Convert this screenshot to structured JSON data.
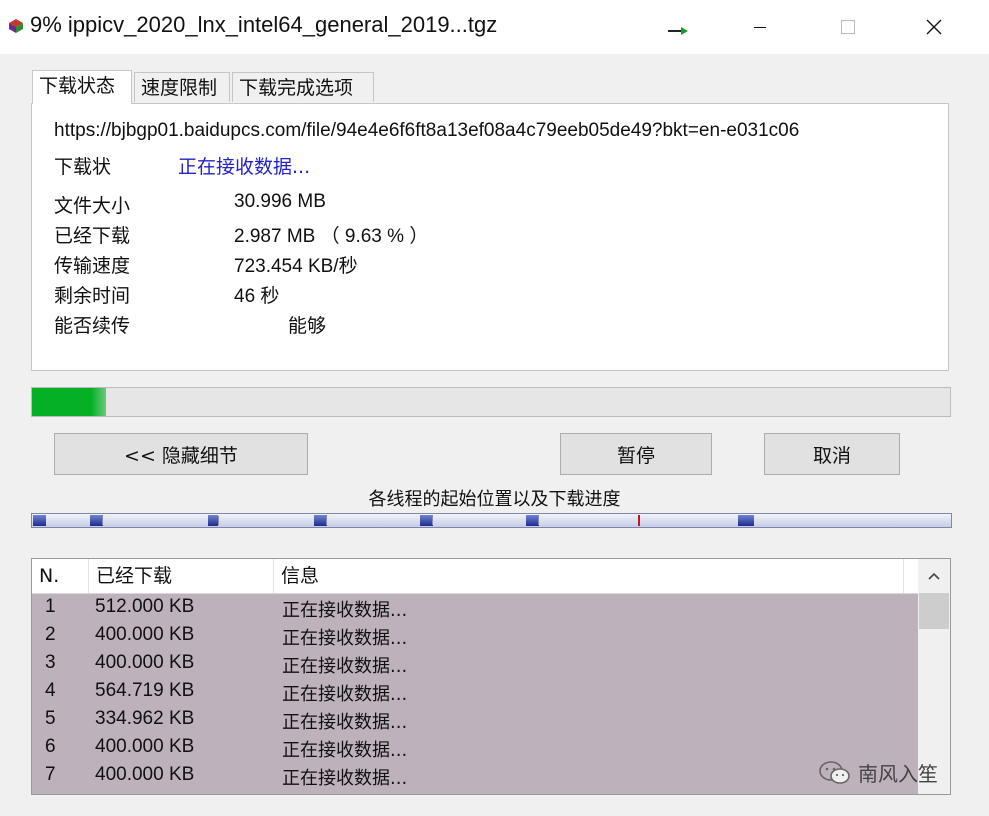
{
  "window": {
    "title": "9% ippicv_2020_lnx_intel64_general_2019...tgz",
    "controls": {
      "minimize": "—",
      "maximize": "☐",
      "close": "✕"
    }
  },
  "tabs": [
    {
      "label": "下载状态",
      "active": true
    },
    {
      "label": "速度限制",
      "active": false
    },
    {
      "label": "下载完成选项",
      "active": false
    }
  ],
  "status": {
    "url": "https://bjbgp01.baidupcs.com/file/94e4e6f6ft8a13ef08a4c79eeb05de49?bkt=en-e031c06",
    "state_label": "下载状",
    "state_value": "正在接收数据...",
    "rows": [
      {
        "label": "文件大小",
        "value": "30.996  MB"
      },
      {
        "label": "已经下载",
        "value": "2.987  MB （ 9.63 % ）"
      },
      {
        "label": "传输速度",
        "value": "723.454  KB/秒"
      },
      {
        "label": "剩余时间",
        "value": "46 秒"
      },
      {
        "label": "能否续传",
        "value": "能够"
      }
    ]
  },
  "progress": {
    "percent": 9.63
  },
  "buttons": {
    "hide_details": "<< 隐藏细节",
    "pause": "暂停",
    "cancel": "取消"
  },
  "threads": {
    "caption": "各线程的起始位置以及下载进度"
  },
  "connections": {
    "columns": [
      "N.",
      "已经下载",
      "信息"
    ],
    "rows": [
      {
        "n": "1",
        "downloaded": "512.000  KB",
        "info": "正在接收数据..."
      },
      {
        "n": "2",
        "downloaded": "400.000  KB",
        "info": "正在接收数据..."
      },
      {
        "n": "3",
        "downloaded": "400.000  KB",
        "info": "正在接收数据..."
      },
      {
        "n": "4",
        "downloaded": "564.719  KB",
        "info": "正在接收数据..."
      },
      {
        "n": "5",
        "downloaded": "334.962  KB",
        "info": "正在接收数据..."
      },
      {
        "n": "6",
        "downloaded": "400.000  KB",
        "info": "正在接收数据..."
      },
      {
        "n": "7",
        "downloaded": "400.000  KB",
        "info": "正在接收数据..."
      }
    ]
  },
  "watermark": {
    "text": "南风入笙"
  },
  "colors": {
    "progress": "#06b025",
    "status_text": "#2323c8",
    "list_bg": "#bdb1bc"
  }
}
